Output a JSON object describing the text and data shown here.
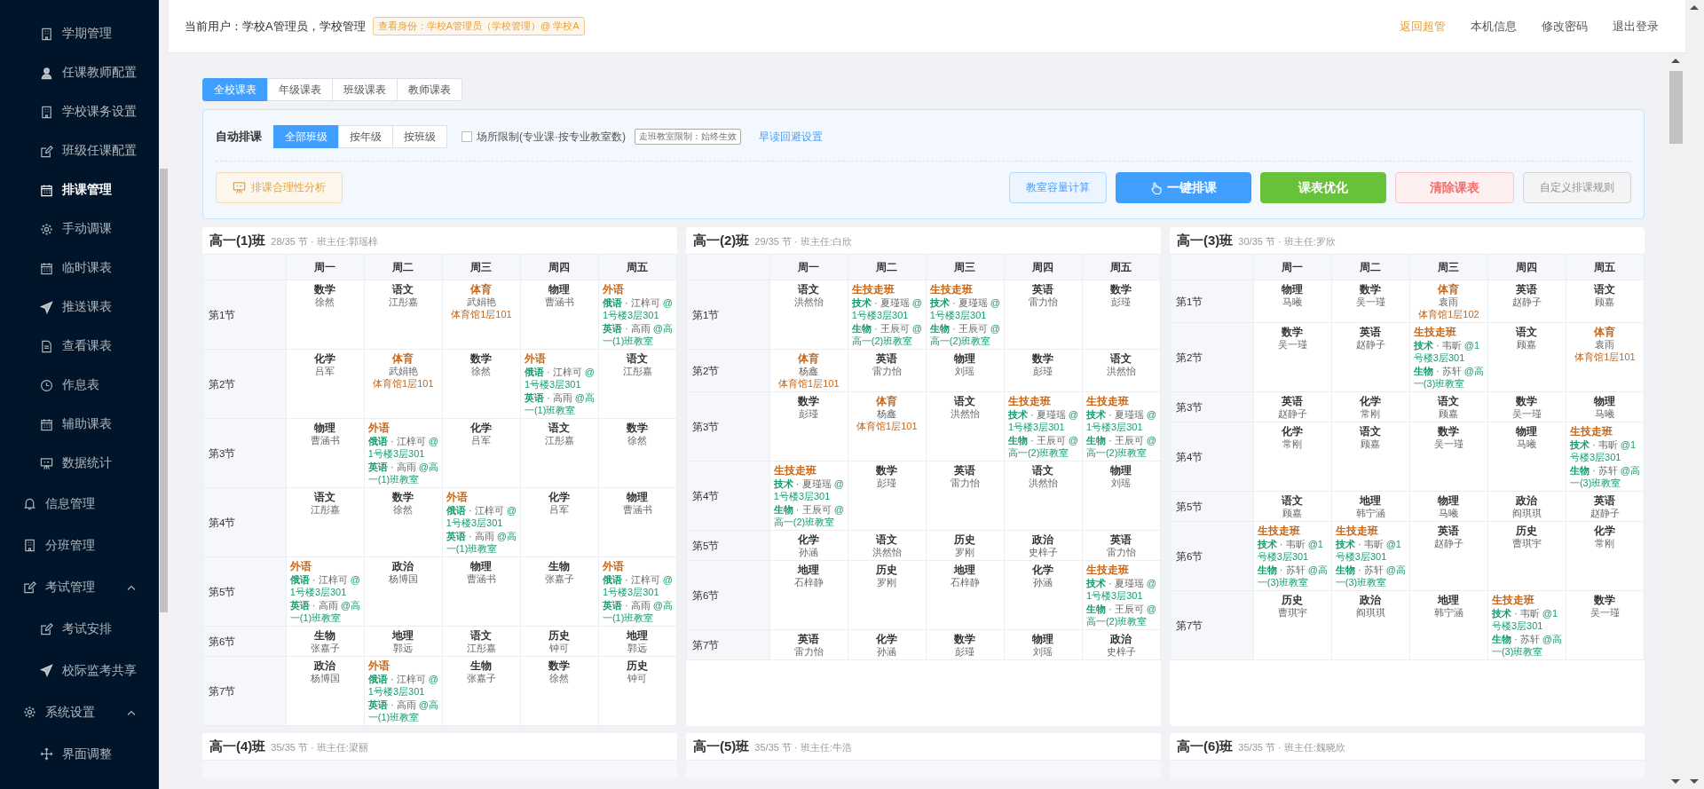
{
  "sidebar": {
    "items": [
      {
        "kind": "sub",
        "label": "学期管理",
        "selected": false
      },
      {
        "kind": "sub",
        "label": "任课教师配置",
        "selected": false
      },
      {
        "kind": "sub",
        "label": "学校课务设置",
        "selected": false
      },
      {
        "kind": "sub",
        "label": "班级任课配置",
        "selected": false
      },
      {
        "kind": "sub",
        "label": "排课管理",
        "selected": true
      },
      {
        "kind": "sub",
        "label": "手动调课",
        "selected": false
      },
      {
        "kind": "sub",
        "label": "临时课表",
        "selected": false
      },
      {
        "kind": "sub",
        "label": "推送课表",
        "selected": false
      },
      {
        "kind": "sub",
        "label": "查看课表",
        "selected": false
      },
      {
        "kind": "sub",
        "label": "作息表",
        "selected": false
      },
      {
        "kind": "sub",
        "label": "辅助课表",
        "selected": false
      },
      {
        "kind": "sub",
        "label": "数据统计",
        "selected": false
      },
      {
        "kind": "menu",
        "label": "信息管理",
        "selected": false
      },
      {
        "kind": "menu",
        "label": "分班管理",
        "selected": false
      },
      {
        "kind": "menu",
        "label": "考试管理",
        "selected": false,
        "expanded": true,
        "children": [
          {
            "label": "考试安排",
            "selected": false
          },
          {
            "label": "校际监考共享",
            "selected": false
          }
        ]
      },
      {
        "kind": "menu",
        "label": "系统设置",
        "selected": false,
        "expanded": true,
        "children": [
          {
            "label": "界面调整",
            "selected": false
          }
        ]
      }
    ]
  },
  "header": {
    "user": "当前用户：学校A管理员，学校管理",
    "identity_badge": "查看身份：学校A管理员（学校管理）@ 学校A",
    "links": [
      {
        "label": "返回超管",
        "kind": "accent"
      },
      {
        "label": "本机信息",
        "kind": "plain"
      },
      {
        "label": "修改密码",
        "kind": "plain"
      },
      {
        "label": "退出登录",
        "kind": "plain"
      }
    ]
  },
  "tabs": [
    {
      "label": "全校课表",
      "selected": true
    },
    {
      "label": "年级课表",
      "selected": false
    },
    {
      "label": "班级课表",
      "selected": false
    },
    {
      "label": "教师课表",
      "selected": false
    }
  ],
  "panel": {
    "label": "自动排课",
    "scope": [
      {
        "label": "全部班级",
        "selected": true
      },
      {
        "label": "按年级",
        "selected": false
      },
      {
        "label": "按班级",
        "selected": false
      }
    ],
    "venue_limit": {
      "label": "场所限制(专业课·按专业教室数)",
      "checked": false
    },
    "tag": "走班教室限制：始终生效",
    "link": "早读回避设置",
    "buttons": [
      {
        "label": "排课合理性分析",
        "kind": "warning-plain"
      },
      {
        "label": "教室容量计算",
        "kind": "primary-plain"
      },
      {
        "label": "一键排课",
        "kind": "primary"
      },
      {
        "label": "课表优化",
        "kind": "success"
      },
      {
        "label": "清除课表",
        "kind": "danger-plain"
      },
      {
        "label": "自定义排课规则",
        "kind": "default"
      }
    ]
  },
  "timetables": [
    {
      "title": "高一(1)班",
      "meta": "28/35 节 · 班主任:郭瑶梓",
      "days": [
        "周一",
        "周二",
        "周三",
        "周四",
        "周五"
      ],
      "rows": [
        {
          "period": "第1节",
          "cells": [
            {
              "kind": "plain",
              "subject": "数学",
              "teacher": "徐然"
            },
            {
              "kind": "plain",
              "subject": "语文",
              "teacher": "江彤嘉"
            },
            {
              "kind": "pe",
              "subject": "体育",
              "teacher": "武娟艳",
              "room": "体育馆1层101"
            },
            {
              "kind": "plain",
              "subject": "物理",
              "teacher": "曹涵书"
            },
            {
              "kind": "group",
              "title": "外语",
              "lines": [
                {
                  "subject": "俄语",
                  "teacher": "· 江梓可",
                  "room": "@1号楼3层301"
                },
                {
                  "subject": "英语",
                  "teacher": "· 高雨",
                  "room": "@高一(1)班教室"
                }
              ]
            }
          ]
        },
        {
          "period": "第2节",
          "cells": [
            {
              "kind": "plain",
              "subject": "化学",
              "teacher": "吕军"
            },
            {
              "kind": "pe",
              "subject": "体育",
              "teacher": "武娟艳",
              "room": "体育馆1层101"
            },
            {
              "kind": "plain",
              "subject": "数学",
              "teacher": "徐然"
            },
            {
              "kind": "group",
              "title": "外语",
              "lines": [
                {
                  "subject": "俄语",
                  "teacher": "· 江梓可",
                  "room": "@1号楼3层301"
                },
                {
                  "subject": "英语",
                  "teacher": "· 高雨",
                  "room": "@高一(1)班教室"
                }
              ]
            },
            {
              "kind": "plain",
              "subject": "语文",
              "teacher": "江彤嘉"
            }
          ]
        },
        {
          "period": "第3节",
          "cells": [
            {
              "kind": "plain",
              "subject": "物理",
              "teacher": "曹涵书"
            },
            {
              "kind": "group",
              "title": "外语",
              "lines": [
                {
                  "subject": "俄语",
                  "teacher": "· 江梓可",
                  "room": "@1号楼3层301"
                },
                {
                  "subject": "英语",
                  "teacher": "· 高雨",
                  "room": "@高一(1)班教室"
                }
              ]
            },
            {
              "kind": "plain",
              "subject": "化学",
              "teacher": "吕军"
            },
            {
              "kind": "plain",
              "subject": "语文",
              "teacher": "江彤嘉"
            },
            {
              "kind": "plain",
              "subject": "数学",
              "teacher": "徐然"
            }
          ]
        },
        {
          "period": "第4节",
          "cells": [
            {
              "kind": "plain",
              "subject": "语文",
              "teacher": "江彤嘉"
            },
            {
              "kind": "plain",
              "subject": "数学",
              "teacher": "徐然"
            },
            {
              "kind": "group",
              "title": "外语",
              "lines": [
                {
                  "subject": "俄语",
                  "teacher": "· 江梓可",
                  "room": "@1号楼3层301"
                },
                {
                  "subject": "英语",
                  "teacher": "· 高雨",
                  "room": "@高一(1)班教室"
                }
              ]
            },
            {
              "kind": "plain",
              "subject": "化学",
              "teacher": "吕军"
            },
            {
              "kind": "plain",
              "subject": "物理",
              "teacher": "曹涵书"
            }
          ]
        },
        {
          "period": "第5节",
          "cells": [
            {
              "kind": "group",
              "title": "外语",
              "lines": [
                {
                  "subject": "俄语",
                  "teacher": "· 江梓可",
                  "room": "@1号楼3层301"
                },
                {
                  "subject": "英语",
                  "teacher": "· 高雨",
                  "room": "@高一(1)班教室"
                }
              ]
            },
            {
              "kind": "plain",
              "subject": "政治",
              "teacher": "杨博国"
            },
            {
              "kind": "plain",
              "subject": "物理",
              "teacher": "曹涵书"
            },
            {
              "kind": "plain",
              "subject": "生物",
              "teacher": "张嘉子"
            },
            {
              "kind": "group",
              "title": "外语",
              "lines": [
                {
                  "subject": "俄语",
                  "teacher": "· 江梓可",
                  "room": "@1号楼3层301"
                },
                {
                  "subject": "英语",
                  "teacher": "· 高雨",
                  "room": "@高一(1)班教室"
                }
              ]
            }
          ]
        },
        {
          "period": "第6节",
          "cells": [
            {
              "kind": "plain",
              "subject": "生物",
              "teacher": "张嘉子"
            },
            {
              "kind": "plain",
              "subject": "地理",
              "teacher": "郭远"
            },
            {
              "kind": "plain",
              "subject": "语文",
              "teacher": "江彤嘉"
            },
            {
              "kind": "plain",
              "subject": "历史",
              "teacher": "钟可"
            },
            {
              "kind": "plain",
              "subject": "地理",
              "teacher": "郭远"
            }
          ]
        },
        {
          "period": "第7节",
          "cells": [
            {
              "kind": "plain",
              "subject": "政治",
              "teacher": "杨博国"
            },
            {
              "kind": "group",
              "title": "外语",
              "lines": [
                {
                  "subject": "俄语",
                  "teacher": "· 江梓可",
                  "room": "@1号楼3层301"
                },
                {
                  "subject": "英语",
                  "teacher": "· 高雨",
                  "room": "@高一(1)班教室"
                }
              ]
            },
            {
              "kind": "plain",
              "subject": "生物",
              "teacher": "张嘉子"
            },
            {
              "kind": "plain",
              "subject": "数学",
              "teacher": "徐然"
            },
            {
              "kind": "plain",
              "subject": "历史",
              "teacher": "钟可"
            }
          ]
        }
      ]
    },
    {
      "title": "高一(2)班",
      "meta": "29/35 节 · 班主任:白欣",
      "days": [
        "周一",
        "周二",
        "周三",
        "周四",
        "周五"
      ],
      "rows": [
        {
          "period": "第1节",
          "cells": [
            {
              "kind": "plain",
              "subject": "语文",
              "teacher": "洪然怡"
            },
            {
              "kind": "group",
              "title": "生技走班",
              "lines": [
                {
                  "subject": "技术",
                  "teacher": "· 夏瑾瑶",
                  "room": "@1号楼3层301"
                },
                {
                  "subject": "生物",
                  "teacher": "· 王辰可",
                  "room": "@高一(2)班教室"
                }
              ]
            },
            {
              "kind": "group",
              "title": "生技走班",
              "lines": [
                {
                  "subject": "技术",
                  "teacher": "· 夏瑾瑶",
                  "room": "@1号楼3层301"
                },
                {
                  "subject": "生物",
                  "teacher": "· 王辰可",
                  "room": "@高一(2)班教室"
                }
              ]
            },
            {
              "kind": "plain",
              "subject": "英语",
              "teacher": "雷力怡"
            },
            {
              "kind": "plain",
              "subject": "数学",
              "teacher": "彭瑾"
            }
          ]
        },
        {
          "period": "第2节",
          "cells": [
            {
              "kind": "pe",
              "subject": "体育",
              "teacher": "杨鑫",
              "room": "体育馆1层101"
            },
            {
              "kind": "plain",
              "subject": "英语",
              "teacher": "雷力怡"
            },
            {
              "kind": "plain",
              "subject": "物理",
              "teacher": "刘瑶"
            },
            {
              "kind": "plain",
              "subject": "数学",
              "teacher": "彭瑾"
            },
            {
              "kind": "plain",
              "subject": "语文",
              "teacher": "洪然怡"
            }
          ]
        },
        {
          "period": "第3节",
          "cells": [
            {
              "kind": "plain",
              "subject": "数学",
              "teacher": "彭瑾"
            },
            {
              "kind": "pe",
              "subject": "体育",
              "teacher": "杨鑫",
              "room": "体育馆1层101"
            },
            {
              "kind": "plain",
              "subject": "语文",
              "teacher": "洪然怡"
            },
            {
              "kind": "group",
              "title": "生技走班",
              "lines": [
                {
                  "subject": "技术",
                  "teacher": "· 夏瑾瑶",
                  "room": "@1号楼3层301"
                },
                {
                  "subject": "生物",
                  "teacher": "· 王辰可",
                  "room": "@高一(2)班教室"
                }
              ]
            },
            {
              "kind": "group",
              "title": "生技走班",
              "lines": [
                {
                  "subject": "技术",
                  "teacher": "· 夏瑾瑶",
                  "room": "@1号楼3层301"
                },
                {
                  "subject": "生物",
                  "teacher": "· 王辰可",
                  "room": "@高一(2)班教室"
                }
              ]
            }
          ]
        },
        {
          "period": "第4节",
          "cells": [
            {
              "kind": "group",
              "title": "生技走班",
              "lines": [
                {
                  "subject": "技术",
                  "teacher": "· 夏瑾瑶",
                  "room": "@1号楼3层301"
                },
                {
                  "subject": "生物",
                  "teacher": "· 王辰可",
                  "room": "@高一(2)班教室"
                }
              ]
            },
            {
              "kind": "plain",
              "subject": "数学",
              "teacher": "彭瑾"
            },
            {
              "kind": "plain",
              "subject": "英语",
              "teacher": "雷力怡"
            },
            {
              "kind": "plain",
              "subject": "语文",
              "teacher": "洪然怡"
            },
            {
              "kind": "plain",
              "subject": "物理",
              "teacher": "刘瑶"
            }
          ]
        },
        {
          "period": "第5节",
          "cells": [
            {
              "kind": "plain",
              "subject": "化学",
              "teacher": "孙涵"
            },
            {
              "kind": "plain",
              "subject": "语文",
              "teacher": "洪然怡"
            },
            {
              "kind": "plain",
              "subject": "历史",
              "teacher": "罗刚"
            },
            {
              "kind": "plain",
              "subject": "政治",
              "teacher": "史梓子"
            },
            {
              "kind": "plain",
              "subject": "英语",
              "teacher": "雷力怡"
            }
          ]
        },
        {
          "period": "第6节",
          "cells": [
            {
              "kind": "plain",
              "subject": "地理",
              "teacher": "石梓静"
            },
            {
              "kind": "plain",
              "subject": "历史",
              "teacher": "罗刚"
            },
            {
              "kind": "plain",
              "subject": "地理",
              "teacher": "石梓静"
            },
            {
              "kind": "plain",
              "subject": "化学",
              "teacher": "孙涵"
            },
            {
              "kind": "group",
              "title": "生技走班",
              "lines": [
                {
                  "subject": "技术",
                  "teacher": "· 夏瑾瑶",
                  "room": "@1号楼3层301"
                },
                {
                  "subject": "生物",
                  "teacher": "· 王辰可",
                  "room": "@高一(2)班教室"
                }
              ]
            }
          ]
        },
        {
          "period": "第7节",
          "cells": [
            {
              "kind": "plain",
              "subject": "英语",
              "teacher": "雷力怡"
            },
            {
              "kind": "plain",
              "subject": "化学",
              "teacher": "孙涵"
            },
            {
              "kind": "plain",
              "subject": "数学",
              "teacher": "彭瑾"
            },
            {
              "kind": "plain",
              "subject": "物理",
              "teacher": "刘瑶"
            },
            {
              "kind": "plain",
              "subject": "政治",
              "teacher": "史梓子"
            }
          ]
        }
      ]
    },
    {
      "title": "高一(3)班",
      "meta": "30/35 节 · 班主任:罗欣",
      "days": [
        "周一",
        "周二",
        "周三",
        "周四",
        "周五"
      ],
      "rows": [
        {
          "period": "第1节",
          "cells": [
            {
              "kind": "plain",
              "subject": "物理",
              "teacher": "马曦"
            },
            {
              "kind": "plain",
              "subject": "数学",
              "teacher": "吴一瑾"
            },
            {
              "kind": "pe",
              "subject": "体育",
              "teacher": "袁雨",
              "room": "体育馆1层102"
            },
            {
              "kind": "plain",
              "subject": "英语",
              "teacher": "赵静子"
            },
            {
              "kind": "plain",
              "subject": "语文",
              "teacher": "顾嘉"
            }
          ]
        },
        {
          "period": "第2节",
          "cells": [
            {
              "kind": "plain",
              "subject": "数学",
              "teacher": "吴一瑾"
            },
            {
              "kind": "plain",
              "subject": "英语",
              "teacher": "赵静子"
            },
            {
              "kind": "group",
              "title": "生技走班",
              "lines": [
                {
                  "subject": "技术",
                  "teacher": "· 韦昕",
                  "room": "@1号楼3层301"
                },
                {
                  "subject": "生物",
                  "teacher": "· 苏轩",
                  "room": "@高一(3)班教室"
                }
              ]
            },
            {
              "kind": "plain",
              "subject": "语文",
              "teacher": "顾嘉"
            },
            {
              "kind": "pe",
              "subject": "体育",
              "teacher": "袁雨",
              "room": "体育馆1层101"
            }
          ]
        },
        {
          "period": "第3节",
          "cells": [
            {
              "kind": "plain",
              "subject": "英语",
              "teacher": "赵静子"
            },
            {
              "kind": "plain",
              "subject": "化学",
              "teacher": "常刚"
            },
            {
              "kind": "plain",
              "subject": "语文",
              "teacher": "顾嘉"
            },
            {
              "kind": "plain",
              "subject": "数学",
              "teacher": "吴一瑾"
            },
            {
              "kind": "plain",
              "subject": "物理",
              "teacher": "马曦"
            }
          ]
        },
        {
          "period": "第4节",
          "cells": [
            {
              "kind": "plain",
              "subject": "化学",
              "teacher": "常刚"
            },
            {
              "kind": "plain",
              "subject": "语文",
              "teacher": "顾嘉"
            },
            {
              "kind": "plain",
              "subject": "数学",
              "teacher": "吴一瑾"
            },
            {
              "kind": "plain",
              "subject": "物理",
              "teacher": "马曦"
            },
            {
              "kind": "group",
              "title": "生技走班",
              "lines": [
                {
                  "subject": "技术",
                  "teacher": "· 韦昕",
                  "room": "@1号楼3层301"
                },
                {
                  "subject": "生物",
                  "teacher": "· 苏轩",
                  "room": "@高一(3)班教室"
                }
              ]
            }
          ]
        },
        {
          "period": "第5节",
          "cells": [
            {
              "kind": "plain",
              "subject": "语文",
              "teacher": "顾嘉"
            },
            {
              "kind": "plain",
              "subject": "地理",
              "teacher": "韩宁涵"
            },
            {
              "kind": "plain",
              "subject": "物理",
              "teacher": "马曦"
            },
            {
              "kind": "plain",
              "subject": "政治",
              "teacher": "阎琪琪"
            },
            {
              "kind": "plain",
              "subject": "英语",
              "teacher": "赵静子"
            }
          ]
        },
        {
          "period": "第6节",
          "cells": [
            {
              "kind": "group",
              "title": "生技走班",
              "lines": [
                {
                  "subject": "技术",
                  "teacher": "· 韦昕",
                  "room": "@1号楼3层301"
                },
                {
                  "subject": "生物",
                  "teacher": "· 苏轩",
                  "room": "@高一(3)班教室"
                }
              ]
            },
            {
              "kind": "group",
              "title": "生技走班",
              "lines": [
                {
                  "subject": "技术",
                  "teacher": "· 韦昕",
                  "room": "@1号楼3层301"
                },
                {
                  "subject": "生物",
                  "teacher": "· 苏轩",
                  "room": "@高一(3)班教室"
                }
              ]
            },
            {
              "kind": "plain",
              "subject": "英语",
              "teacher": "赵静子"
            },
            {
              "kind": "plain",
              "subject": "历史",
              "teacher": "曹琪宇"
            },
            {
              "kind": "plain",
              "subject": "化学",
              "teacher": "常刚"
            }
          ]
        },
        {
          "period": "第7节",
          "cells": [
            {
              "kind": "plain",
              "subject": "历史",
              "teacher": "曹琪宇"
            },
            {
              "kind": "plain",
              "subject": "政治",
              "teacher": "阎琪琪"
            },
            {
              "kind": "plain",
              "subject": "地理",
              "teacher": "韩宁涵"
            },
            {
              "kind": "group",
              "title": "生技走班",
              "lines": [
                {
                  "subject": "技术",
                  "teacher": "· 韦昕",
                  "room": "@1号楼3层301"
                },
                {
                  "subject": "生物",
                  "teacher": "· 苏轩",
                  "room": "@高一(3)班教室"
                }
              ]
            },
            {
              "kind": "plain",
              "subject": "数学",
              "teacher": "吴一瑾"
            }
          ]
        }
      ]
    },
    {
      "title": "高一(4)班",
      "meta": "35/35 节 · 班主任:梁丽"
    },
    {
      "title": "高一(5)班",
      "meta": "35/35 节 · 班主任:牛浩"
    },
    {
      "title": "高一(6)班",
      "meta": "35/35 节 · 班主任:魏晓欣"
    }
  ]
}
